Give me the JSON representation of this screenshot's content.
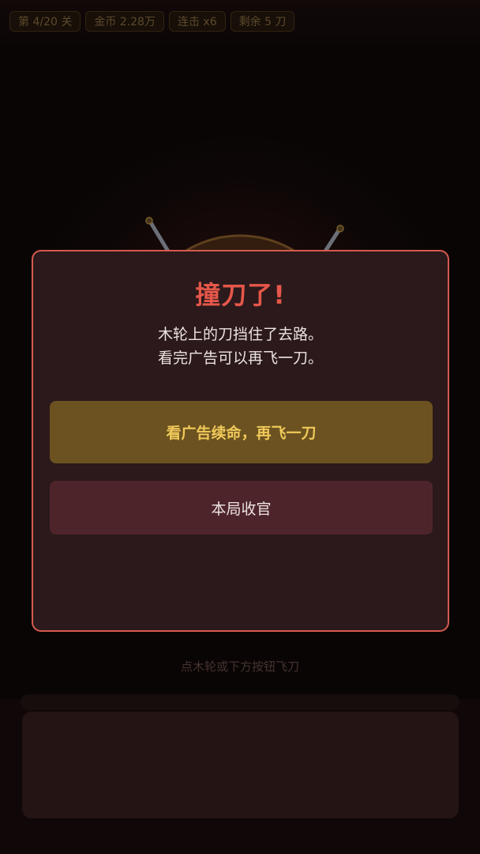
{
  "hud": {
    "level": "第 4/20 关",
    "coins": "金币 2.28万",
    "combo": "连击 x6",
    "remaining": "剩余 5 刀"
  },
  "game": {
    "hint": "点木轮或下方按钮飞刀"
  },
  "modal": {
    "title": "撞刀了!",
    "message_line1": "木轮上的刀挡住了去路。",
    "message_line2": "看完广告可以再飞一刀。",
    "ad_button": "看广告续命，再飞一刀",
    "end_button": "本局收官"
  },
  "colors": {
    "accent_red": "#e5574a",
    "modal_border": "#d65a4e",
    "ad_button_bg": "#6b5220",
    "ad_button_text": "#f1c95a",
    "end_button_bg": "#4e242b",
    "modal_bg": "#2b191b"
  }
}
